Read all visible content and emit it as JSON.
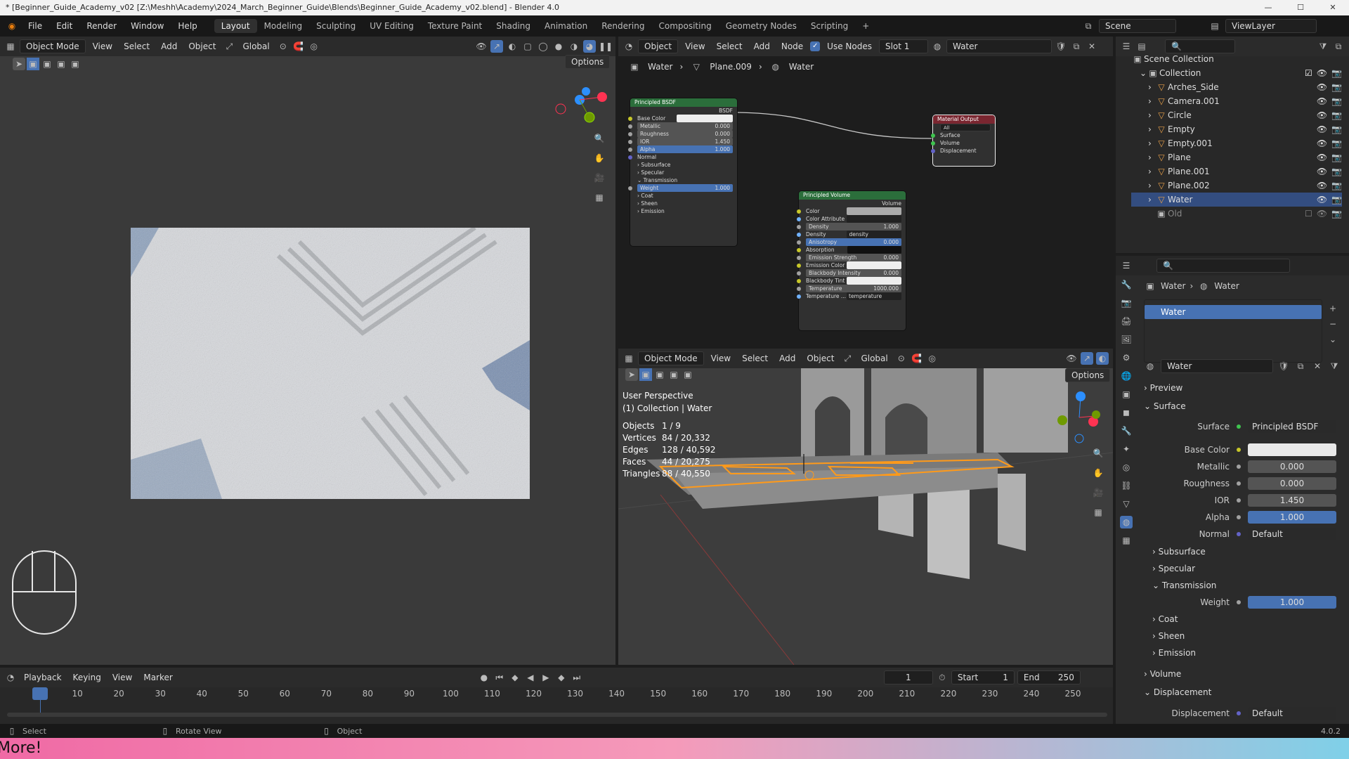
{
  "title_bar": {
    "text": "* [Beginner_Guide_Academy_v02 [Z:\\Meshh\\Academy\\2024_March_Beginner_Guide\\Blends\\Beginner_Guide_Academy_v02.blend] - Blender 4.0"
  },
  "menu": [
    "File",
    "Edit",
    "Render",
    "Window",
    "Help"
  ],
  "workspaces": [
    "Layout",
    "Modeling",
    "Sculpting",
    "UV Editing",
    "Texture Paint",
    "Shading",
    "Animation",
    "Rendering",
    "Compositing",
    "Geometry Nodes",
    "Scripting"
  ],
  "active_workspace": "Layout",
  "scene": "Scene",
  "view_layer": "ViewLayer",
  "left_viewport": {
    "mode": "Object Mode",
    "menus": [
      "View",
      "Select",
      "Add",
      "Object"
    ],
    "transform": "Global",
    "options": "Options"
  },
  "node_editor": {
    "type": "Object",
    "menus": [
      "View",
      "Select",
      "Add",
      "Node"
    ],
    "use_nodes": "Use Nodes",
    "slot": "Slot 1",
    "material": "Water",
    "breadcrumb": [
      "Water",
      "Plane.009",
      "Water"
    ],
    "bsdf": {
      "title": "Principled BSDF",
      "out": "BSDF",
      "base_color": "Base Color",
      "metallic": [
        "Metallic",
        "0.000"
      ],
      "roughness": [
        "Roughness",
        "0.000"
      ],
      "ior": [
        "IOR",
        "1.450"
      ],
      "alpha": [
        "Alpha",
        "1.000"
      ],
      "normal": "Normal",
      "subsurface": "Subsurface",
      "specular": "Specular",
      "transmission": "Transmission",
      "weight": [
        "Weight",
        "1.000"
      ],
      "coat": "Coat",
      "sheen": "Sheen",
      "emission": "Emission"
    },
    "output": {
      "title": "Material Output",
      "target": "All",
      "surface": "Surface",
      "volume": "Volume",
      "displacement": "Displacement"
    },
    "volume": {
      "title": "Principled Volume",
      "out": "Volume",
      "color": "Color",
      "color_attr": "Color Attribute",
      "density": [
        "Density",
        "1.000"
      ],
      "density_attr": [
        "Density Attrib...",
        "density"
      ],
      "anisotropy": [
        "Anisotropy",
        "0.000"
      ],
      "absorption": "Absorption Co...",
      "emission_strength": [
        "Emission Strength",
        "0.000"
      ],
      "emission_color": "Emission Color",
      "blackbody": [
        "Blackbody Intensity",
        "0.000"
      ],
      "blackbody_tint": "Blackbody Tint",
      "temperature": [
        "Temperature",
        "1000.000"
      ],
      "temp_attr": [
        "Temperature ...",
        "temperature"
      ]
    }
  },
  "right_viewport": {
    "mode": "Object Mode",
    "menus": [
      "View",
      "Select",
      "Add",
      "Object"
    ],
    "transform": "Global",
    "options": "Options",
    "perspective": "User Perspective",
    "collection": "(1) Collection | Water",
    "stats": [
      [
        "Objects",
        "1 / 9"
      ],
      [
        "Vertices",
        "84 / 20,332"
      ],
      [
        "Edges",
        "128 / 40,592"
      ],
      [
        "Faces",
        "44 / 20,275"
      ],
      [
        "Triangles",
        "88 / 40,550"
      ]
    ]
  },
  "outliner": {
    "root": "Scene Collection",
    "collection": "Collection",
    "items": [
      "Arches_Side",
      "Camera.001",
      "Circle",
      "Empty",
      "Empty.001",
      "Plane",
      "Plane.001",
      "Plane.002",
      "Water"
    ],
    "old": "Old"
  },
  "properties": {
    "breadcrumb": [
      "Water",
      "Water"
    ],
    "slot": "Water",
    "material": "Water",
    "preview": "Preview",
    "surface_section": "Surface",
    "surface": [
      "Surface",
      "Principled BSDF"
    ],
    "base_color": "Base Color",
    "metallic": [
      "Metallic",
      "0.000"
    ],
    "roughness": [
      "Roughness",
      "0.000"
    ],
    "ior": [
      "IOR",
      "1.450"
    ],
    "alpha": [
      "Alpha",
      "1.000"
    ],
    "normal": [
      "Normal",
      "Default"
    ],
    "subsurface": "Subsurface",
    "specular": "Specular",
    "transmission": "Transmission",
    "weight": [
      "Weight",
      "1.000"
    ],
    "coat": "Coat",
    "sheen": "Sheen",
    "emission": "Emission",
    "volume": "Volume",
    "displacement_section": "Displacement",
    "displacement": [
      "Displacement",
      "Default"
    ]
  },
  "timeline": {
    "menus": [
      "Playback",
      "Keying",
      "View",
      "Marker"
    ],
    "current": "1",
    "start_label": "Start",
    "start": "1",
    "end_label": "End",
    "end": "250",
    "ticks": [
      "1",
      "10",
      "20",
      "30",
      "40",
      "50",
      "60",
      "70",
      "80",
      "90",
      "100",
      "110",
      "120",
      "130",
      "140",
      "150",
      "160",
      "170",
      "180",
      "190",
      "200",
      "210",
      "220",
      "230",
      "240",
      "250"
    ]
  },
  "status": {
    "select": "Select",
    "rotate": "Rotate View",
    "object": "Object",
    "version": "4.0.2"
  },
  "banner": "More!"
}
